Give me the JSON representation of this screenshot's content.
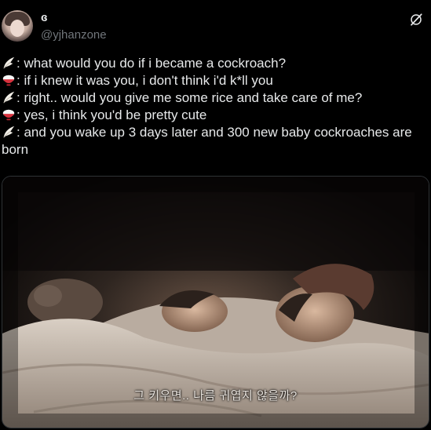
{
  "author": {
    "display_name": "ɞ",
    "handle": "@yjhanzone"
  },
  "post": {
    "lines": [
      {
        "speaker_icon": "wing-emoji-icon",
        "text": ": what would you do if i became a cockroach?"
      },
      {
        "speaker_icon": "rice-bowl-emoji-icon",
        "text": ": if i knew it was you, i don't think i'd k*ll you"
      },
      {
        "speaker_icon": "wing-emoji-icon",
        "text": ": right.. would you give me some rice and take care of me?"
      },
      {
        "speaker_icon": "rice-bowl-emoji-icon",
        "text": ": yes, i think you'd be pretty cute"
      },
      {
        "speaker_icon": "wing-emoji-icon",
        "text": ": and you wake up 3 days later and 300 new baby cockroaches are born"
      }
    ]
  },
  "media": {
    "subtitle": "그 키우면.. 나름 귀엽지 않을까?"
  },
  "colors": {
    "background": "#000000",
    "text_primary": "#e7e9ea",
    "text_secondary": "#71767b"
  }
}
